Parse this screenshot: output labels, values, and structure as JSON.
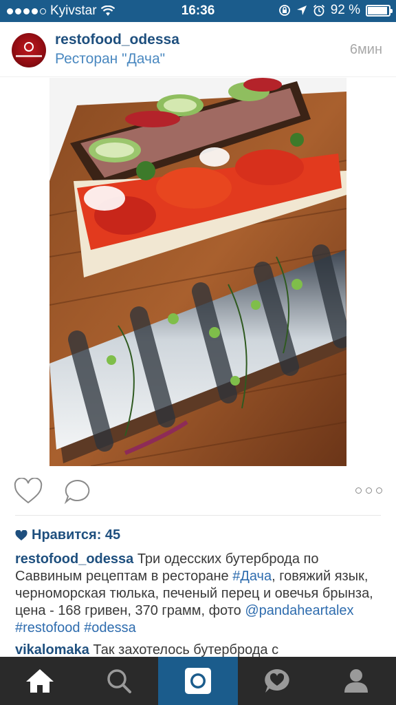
{
  "status_bar": {
    "carrier": "Kyivstar",
    "time": "16:36",
    "battery": "92 %",
    "battery_level": 0.92
  },
  "post": {
    "username": "restofood_odessa",
    "location": "Ресторан \"Дача\"",
    "time_ago": "6мин",
    "avatar_icon": "restaurant-logo"
  },
  "actions": {
    "like_icon": "heart-outline-icon",
    "comment_icon": "comment-bubble-icon",
    "more_icon": "more-dots-icon"
  },
  "likes": {
    "label": "Нравится: 45"
  },
  "caption": {
    "username": "restofood_odessa",
    "text_1": " Три одесских бутерброда по Саввиным рецептам в ресторане ",
    "tag_1": "#Дача",
    "text_2": ", говяжий язык, черноморская тюлька, печеный перец и овечья брынза, цена - 168 гривен, 370 грамм, фото ",
    "mention": "@pandaheartalex",
    "text_3": " ",
    "tag_2": "#restofood",
    "text_4": " ",
    "tag_3": "#odessa"
  },
  "comment": {
    "username": "vikalomaka",
    "text": " Так захотелось бутерброда с"
  },
  "tabbar": {
    "items": [
      "home",
      "search",
      "camera",
      "activity",
      "profile"
    ],
    "active": "camera"
  },
  "colors": {
    "status_bar": "#1b5c8c",
    "link": "#1e4f7e",
    "tab_bar": "#2a2a2a"
  }
}
